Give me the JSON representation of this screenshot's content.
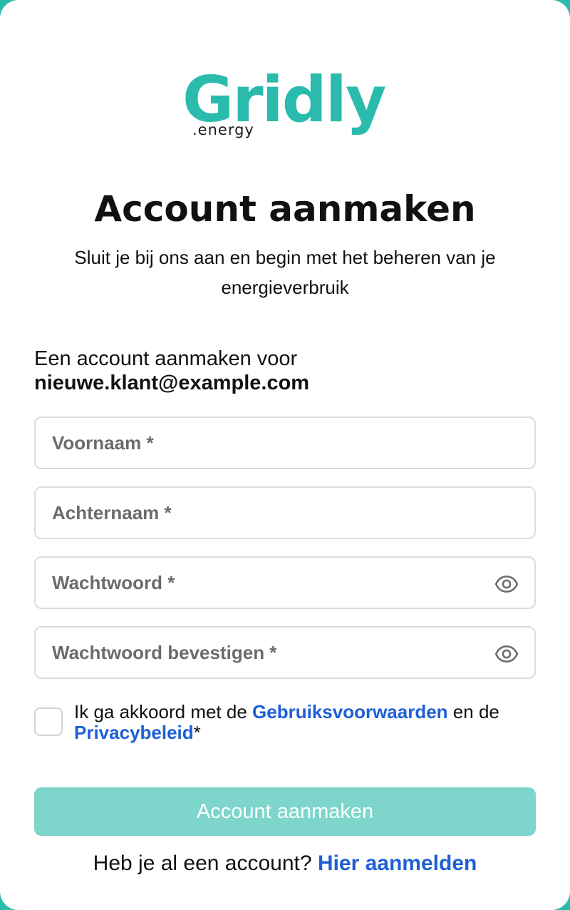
{
  "brand": {
    "name": "Gridly",
    "suffix": ".energy",
    "color": "#2bbbad"
  },
  "page": {
    "title": "Account aanmaken",
    "subtitle": "Sluit je bij ons aan en begin met het beheren van je energieverbruik",
    "account_for_label": "Een account aanmaken voor",
    "email": "nieuwe.klant@example.com"
  },
  "form": {
    "first_name": {
      "placeholder": "Voornaam *",
      "value": ""
    },
    "last_name": {
      "placeholder": "Achternaam *",
      "value": ""
    },
    "password": {
      "placeholder": "Wachtwoord *",
      "value": "",
      "icon": "eye-icon"
    },
    "password_confirm": {
      "placeholder": "Wachtwoord bevestigen *",
      "value": "",
      "icon": "eye-icon"
    },
    "terms": {
      "checked": false,
      "prefix": "Ik ga akkoord met de ",
      "terms_link": "Gebruiksvoorwaarden",
      "middle": " en de ",
      "privacy_link": "Privacybeleid",
      "suffix": "*"
    },
    "submit_label": "Account aanmaken",
    "submit_color": "#7dd5cc",
    "submit_enabled": false
  },
  "footer": {
    "prompt": "Heb je al een account? ",
    "login_link": "Hier aanmelden",
    "link_color": "#1e5fd6"
  }
}
